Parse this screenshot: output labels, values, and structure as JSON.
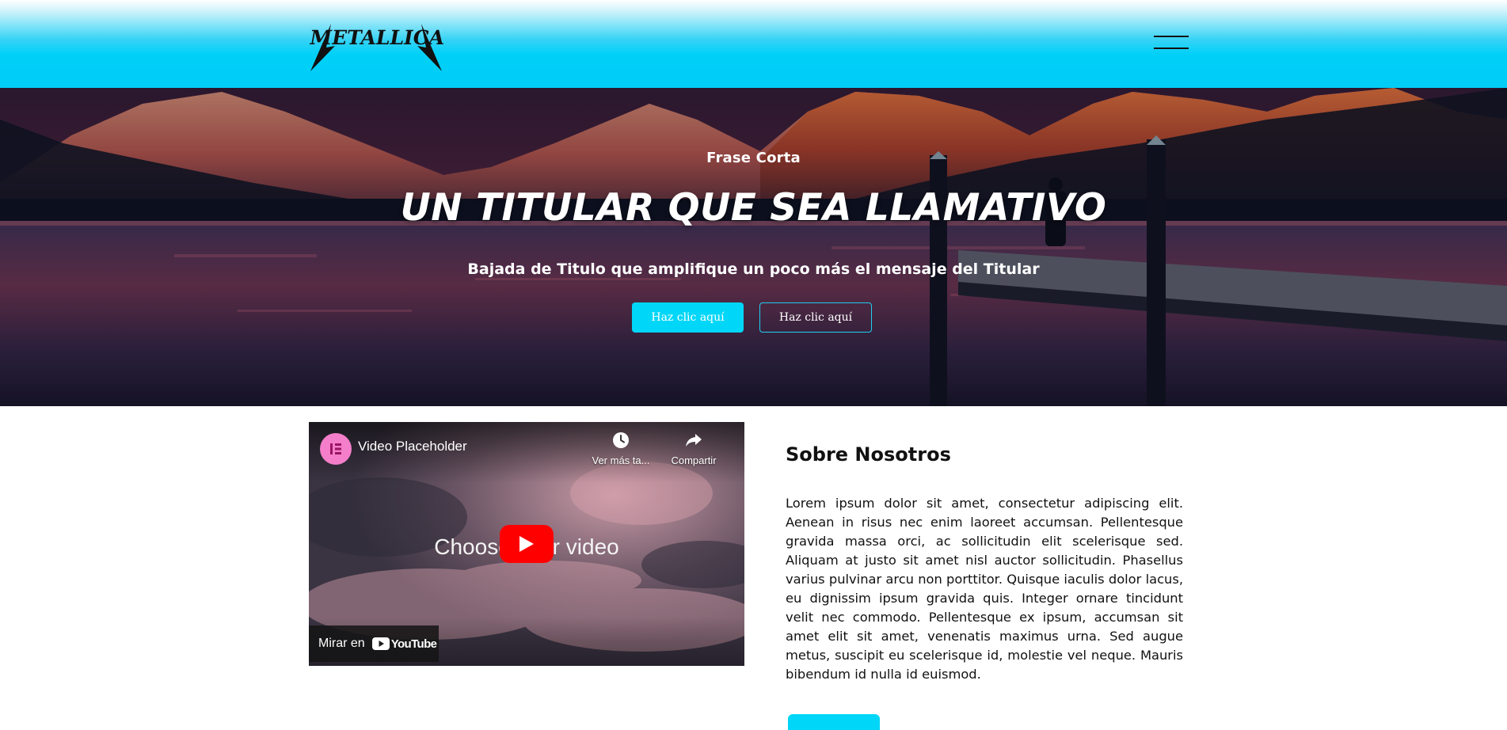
{
  "header": {
    "logo_text": "METALLICA",
    "menu_icon": "hamburger-menu-icon"
  },
  "hero": {
    "kicker": "Frase Corta",
    "headline": "UN TITULAR QUE SEA LLAMATIVO",
    "subtitle": "Bajada de Titulo que amplifique un poco más el mensaje del Titular",
    "button_primary": "Haz clic aquí",
    "button_secondary": "Haz clic aquí"
  },
  "video": {
    "channel_icon": "elementor-logo-icon",
    "title": "Video Placeholder",
    "watch_later_label": "Ver más ta...",
    "share_label": "Compartir",
    "center_text": "Choose your video",
    "play_icon": "play-icon",
    "watch_on_label": "Mirar en",
    "youtube_label": "YouTube"
  },
  "about": {
    "title": "Sobre Nosotros",
    "body": "Lorem ipsum dolor sit amet, consectetur adipiscing elit. Aenean in risus nec enim laoreet accumsan. Pellentesque gravida massa orci, ac sollicitudin elit scelerisque sed. Aliquam at justo sit amet nisl auctor sollicitudin. Phasellus varius pulvinar arcu non porttitor. Quisque iaculis dolor lacus, eu dignissim ipsum gravida quis. Integer ornare tincidunt velit nec commodo. Pellentesque ex ipsum, accumsan sit amet elit sit amet, venenatis maximus urna. Sed augue metus, suscipit eu scelerisque id, molestie vel neque. Mauris bibendum id nulla id euismod."
  },
  "colors": {
    "accent": "#00d6f7",
    "youtube_red": "#ff0000"
  }
}
